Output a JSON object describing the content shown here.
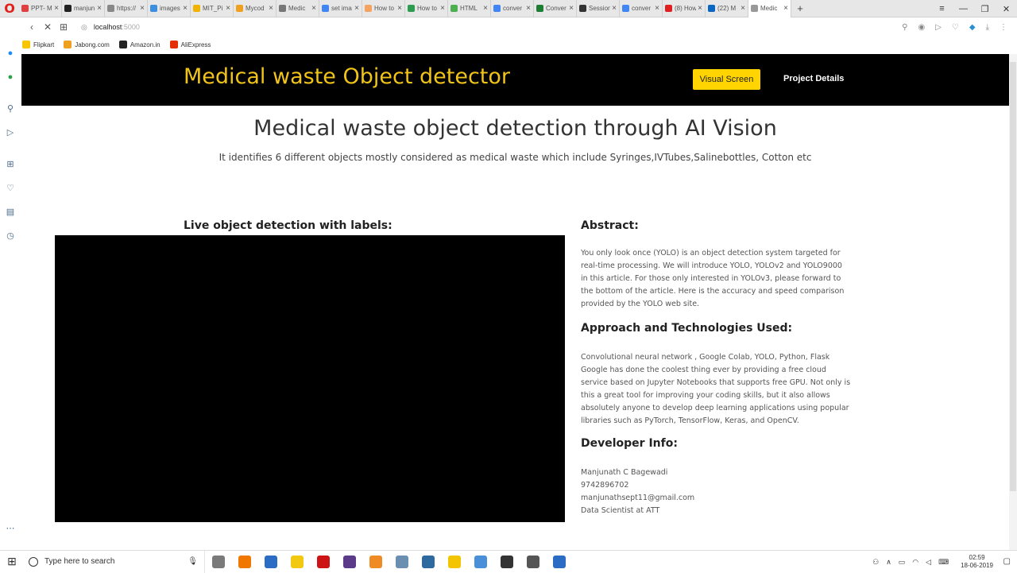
{
  "browser": {
    "tabs": [
      {
        "label": "PPT- M",
        "color": "#e04040"
      },
      {
        "label": "manjun",
        "color": "#222222"
      },
      {
        "label": "https://",
        "color": "#888888"
      },
      {
        "label": "images",
        "color": "#3c8ee0"
      },
      {
        "label": "MIT_Pi",
        "color": "#f0b400"
      },
      {
        "label": "Mycod",
        "color": "#f0a020"
      },
      {
        "label": "Medic",
        "color": "#777777"
      },
      {
        "label": "set ima",
        "color": "#4285f4"
      },
      {
        "label": "How to",
        "color": "#f4a460"
      },
      {
        "label": "How to",
        "color": "#2e9c4e"
      },
      {
        "label": "HTML",
        "color": "#4caf50"
      },
      {
        "label": "conver",
        "color": "#4285f4"
      },
      {
        "label": "Conver",
        "color": "#1e7e34"
      },
      {
        "label": "Session",
        "color": "#333333"
      },
      {
        "label": "conver",
        "color": "#4285f4"
      },
      {
        "label": "(8) How",
        "color": "#e02020"
      },
      {
        "label": "(22) M",
        "color": "#0a66c2"
      },
      {
        "label": "Medic",
        "color": "#999999",
        "active": true
      }
    ],
    "address": {
      "host": "localhost",
      "port": ":5000"
    },
    "bookmarks": [
      {
        "label": "Flipkart",
        "color": "#f7c600"
      },
      {
        "label": "Jabong.com",
        "color": "#f0a020"
      },
      {
        "label": "Amazon.in",
        "color": "#222222"
      },
      {
        "label": "AliExpress",
        "color": "#e62e04"
      }
    ]
  },
  "app": {
    "brand": "Medical waste Object detector",
    "nav": {
      "visual_screen": "Visual Screen",
      "project_details": "Project Details"
    },
    "headline": "Medical waste object detection through AI Vision",
    "subline": "It identifies 6 different objects mostly considered as medical waste which include Syringes,IVTubes,Salinebottles, Cotton etc",
    "live_title": "Live object detection with labels:",
    "abstract": {
      "title": "Abstract:",
      "body": "You only look once (YOLO) is an object detection system targeted for real-time processing. We will introduce YOLO, YOLOv2 and YOLO9000 in this article. For those only interested in YOLOv3, please forward to the bottom of the article. Here is the accuracy and speed comparison provided by the YOLO web site."
    },
    "approach": {
      "title": "Approach and Technologies Used:",
      "body": "Convolutional neural network , Google Colab, YOLO, Python, Flask Google has done the coolest thing ever by providing a free cloud service based on Jupyter Notebooks that supports free GPU. Not only is this a great tool for improving your coding skills, but it also allows absolutely anyone to develop deep learning applications using popular libraries such as PyTorch, TensorFlow, Keras, and OpenCV."
    },
    "developer": {
      "title": "Developer Info:",
      "name": "Manjunath C Bagewadi",
      "phone": "9742896702",
      "email": "manjunathsept11@gmail.com",
      "role": "Data Scientist at ATT"
    }
  },
  "taskbar": {
    "search_placeholder": "Type here to search",
    "time": "02:59",
    "date": "18-06-2019",
    "apps": [
      "#7a7a7a",
      "#f07800",
      "#2b6cc4",
      "#f2c811",
      "#cc1414",
      "#5b3a8a",
      "#f08a24",
      "#6a8fb0",
      "#2d6aa0",
      "#f2c500",
      "#4a90d9",
      "#333333",
      "#555555",
      "#2b6cc4"
    ]
  }
}
